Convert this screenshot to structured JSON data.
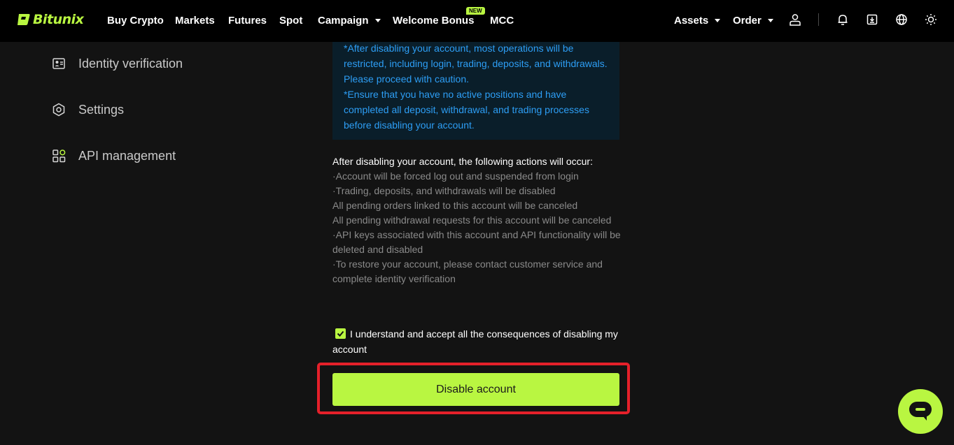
{
  "brand": {
    "name": "Bitunix",
    "accent_color": "#b9f641"
  },
  "nav": {
    "items": [
      {
        "label": "Buy Crypto"
      },
      {
        "label": "Markets"
      },
      {
        "label": "Futures"
      },
      {
        "label": "Spot"
      },
      {
        "label": "Campaign"
      },
      {
        "label": "Welcome Bonus"
      },
      {
        "label": "MCC"
      }
    ],
    "new_badge": "NEW",
    "right": {
      "assets_label": "Assets",
      "order_label": "Order"
    },
    "icons": [
      "user-icon",
      "bell-icon",
      "download-icon",
      "globe-icon",
      "sun-icon"
    ]
  },
  "sidebar": {
    "items": [
      {
        "label": "Identity verification",
        "icon": "id-card-icon"
      },
      {
        "label": "Settings",
        "icon": "hexagon-settings-icon"
      },
      {
        "label": "API management",
        "icon": "grid-icon"
      }
    ]
  },
  "warning": {
    "lines": [
      "*After disabling your account, most operations will be restricted, including login, trading, deposits, and withdrawals. Please proceed with caution.",
      "*Ensure that you have no active positions and have completed all deposit, withdrawal, and trading processes before disabling your account."
    ],
    "color": "#2d9ef5"
  },
  "actions": {
    "title": "After disabling your account, the following actions will occur:",
    "items": [
      "·Account will be forced log out and suspended from login",
      "·Trading, deposits, and withdrawals will be disabled",
      "All pending orders linked to this account will be canceled",
      "All pending withdrawal requests for this account will be canceled",
      "·API keys associated with this account and API functionality will be deleted and disabled",
      "·To restore your account, please contact customer service and complete identity verification"
    ]
  },
  "agreement": {
    "label": "I understand and accept all the consequences of disabling my account",
    "checked": true
  },
  "primary_action": {
    "label": "Disable account"
  }
}
